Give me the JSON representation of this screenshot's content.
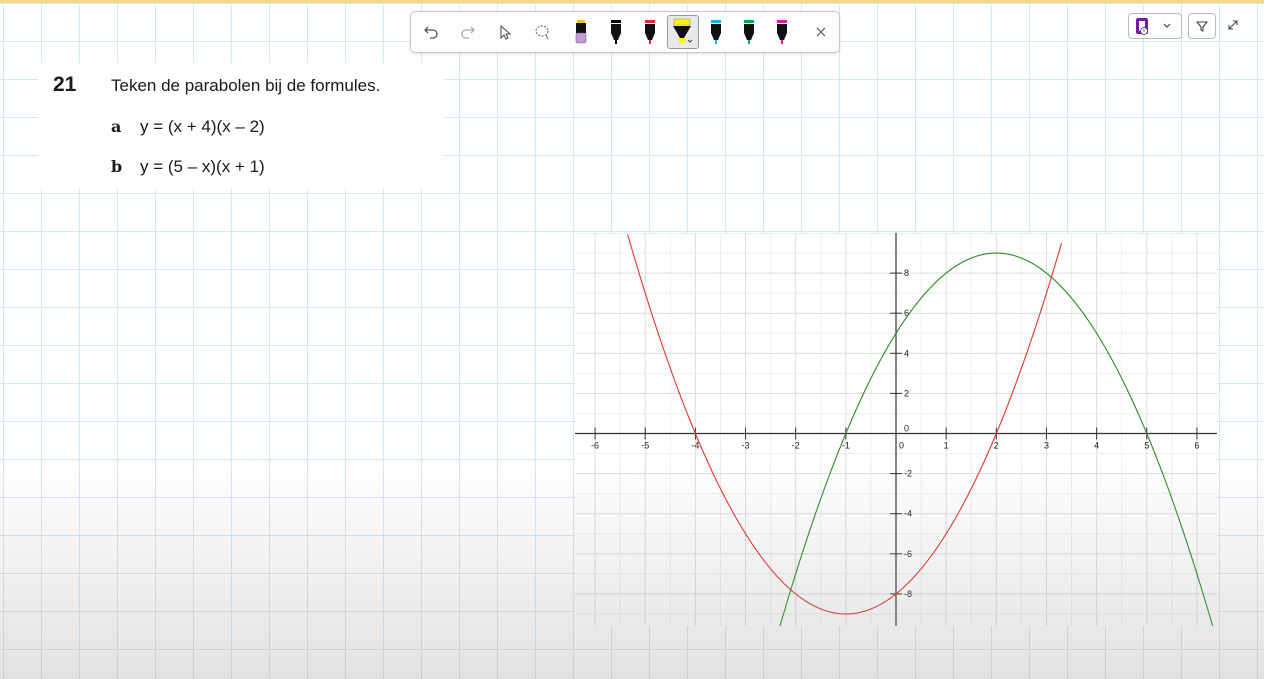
{
  "toolbar": {
    "tools": [
      "undo-icon",
      "redo-icon",
      "select-pointer-icon",
      "lasso-icon",
      "eraser-pen-icon",
      "pen-black-icon",
      "pen-red-icon",
      "highlighter-yellow-icon",
      "pen-cyan-icon",
      "pen-green-icon",
      "pen-magenta-icon",
      "close-icon"
    ],
    "colors": {
      "eraser": "#c49bd8",
      "black": "#000000",
      "red": "#e0243a",
      "yellow": "#fff200",
      "cyan": "#18b3e6",
      "green": "#10a35a",
      "magenta": "#d41ea6"
    }
  },
  "exercise": {
    "number": "21",
    "instruction": "Teken de parabolen bij de formules.",
    "parts": [
      {
        "letter": "a",
        "formula": "y = (x + 4)(x – 2)"
      },
      {
        "letter": "b",
        "formula": "y = (5 – x)(x + 1)"
      }
    ]
  },
  "chart_data": {
    "type": "line",
    "title": "",
    "xlabel": "",
    "ylabel": "",
    "xlim": [
      -6.4,
      6.4
    ],
    "ylim": [
      -9.6,
      10
    ],
    "grid": true,
    "xticks": [
      -6,
      -5,
      -4,
      -3,
      -2,
      -1,
      0,
      1,
      2,
      3,
      4,
      5,
      6
    ],
    "yticks": [
      -8,
      -6,
      -4,
      -2,
      0,
      2,
      4,
      6,
      8
    ],
    "series": [
      {
        "formula": "y = (x + 4)(x – 2)",
        "color": "#e0342f",
        "xrange": [
          -5.35,
          3.3
        ]
      },
      {
        "formula": "y = (5 – x)(x + 1)",
        "color": "#2a8a2a",
        "xrange": [
          -2.35,
          6.35
        ]
      }
    ]
  }
}
